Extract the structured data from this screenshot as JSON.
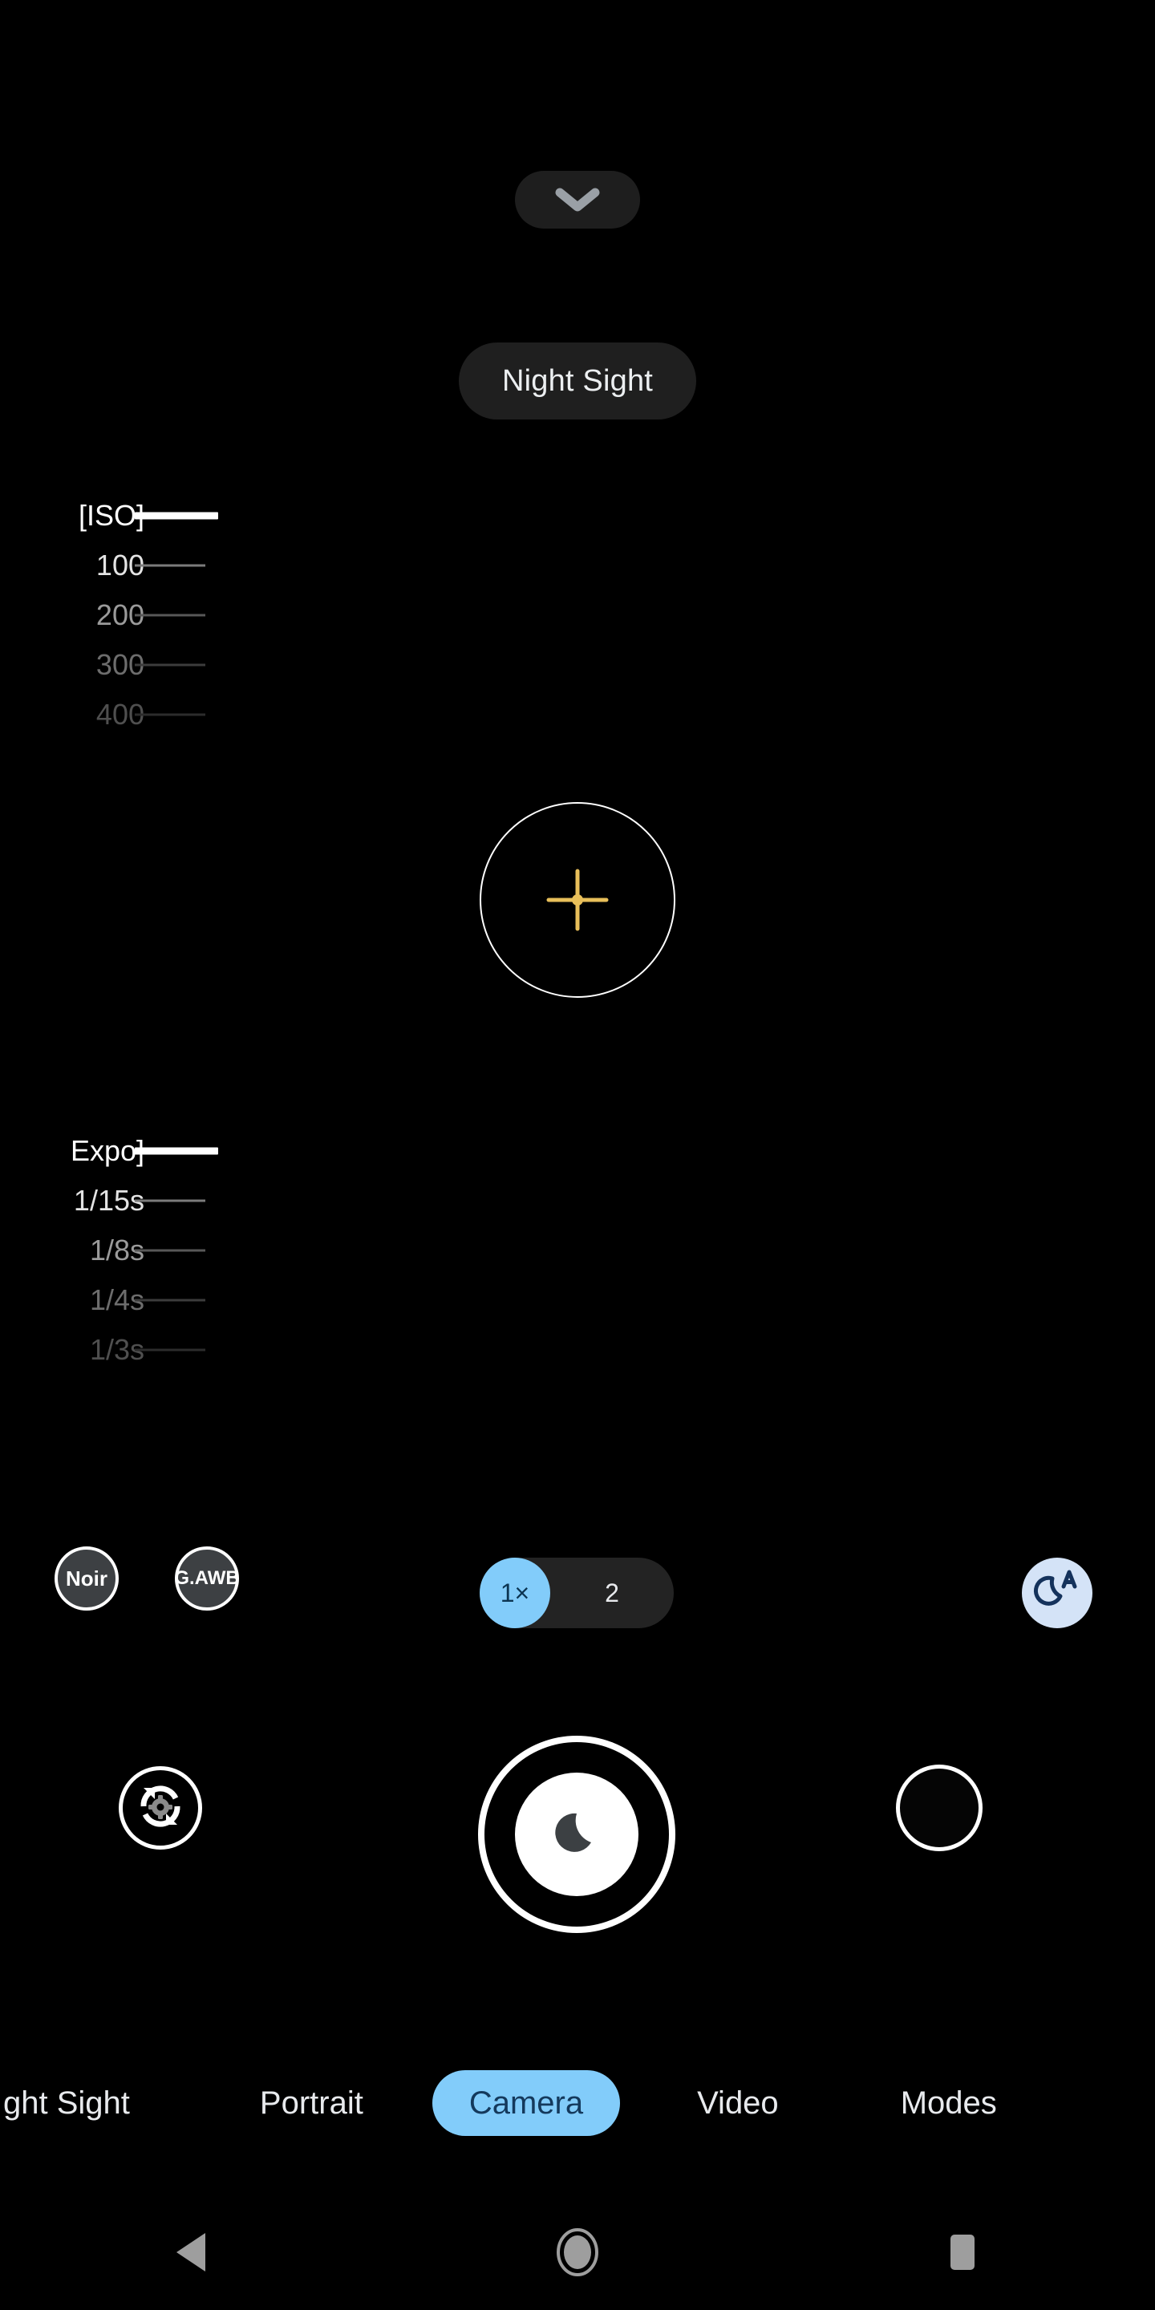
{
  "app": {
    "name": "Camera",
    "mode_badge": "Night Sight",
    "accent_blue": "#82ccfa",
    "accent_blue_text": "#14395c",
    "chip_fill": "#3d4043",
    "pill_fill": "#1f1f1f",
    "night_auto_fill": "#d4e3f7",
    "night_auto_glyph": "#14325c"
  },
  "top_bar": {
    "collapse_icon": "chevron-down-icon"
  },
  "iso_slider": {
    "title": "[ISO]",
    "name": "iso",
    "selected_value": "[ISO]",
    "rows": [
      {
        "label": "[ISO]",
        "state": "active"
      },
      {
        "label": "100",
        "state": "lvl1"
      },
      {
        "label": "200",
        "state": "lvl2"
      },
      {
        "label": "300",
        "state": "lvl3"
      },
      {
        "label": "400",
        "state": "lvl4"
      }
    ]
  },
  "exposure_slider": {
    "title": "Expo]",
    "name": "exposure",
    "selected_value": "Expo]",
    "rows": [
      {
        "label": "Expo]",
        "state": "active"
      },
      {
        "label": "1/15s",
        "state": "lvl1"
      },
      {
        "label": "1/8s",
        "state": "lvl2"
      },
      {
        "label": "1/4s",
        "state": "lvl3"
      },
      {
        "label": "1/3s",
        "state": "lvl4"
      }
    ]
  },
  "focus": {
    "icon": "focus-reticle-icon",
    "crosshair_color": "#e8bf5a"
  },
  "chips": {
    "noir": "Noir",
    "awb": "G.AWB"
  },
  "zoom_toggle": {
    "options": [
      {
        "label": "1×",
        "selected": true
      },
      {
        "label": "2",
        "selected": false
      }
    ]
  },
  "night_auto": {
    "icon": "night-mode-auto-icon",
    "letter": "A"
  },
  "capture_row": {
    "flip_icon": "flip-camera-settings-icon",
    "shutter_icon": "night-sight-moon-icon",
    "gallery_icon": "gallery-thumbnail-icon"
  },
  "mode_tabs": [
    {
      "label": "ght Sight",
      "selected": false
    },
    {
      "label": "Portrait",
      "selected": false
    },
    {
      "label": "Camera",
      "selected": true
    },
    {
      "label": "Video",
      "selected": false
    },
    {
      "label": "Modes",
      "selected": false
    }
  ],
  "nav_bar": {
    "back": "back-triangle-icon",
    "home": "home-circle-icon",
    "recents": "recents-square-icon"
  }
}
